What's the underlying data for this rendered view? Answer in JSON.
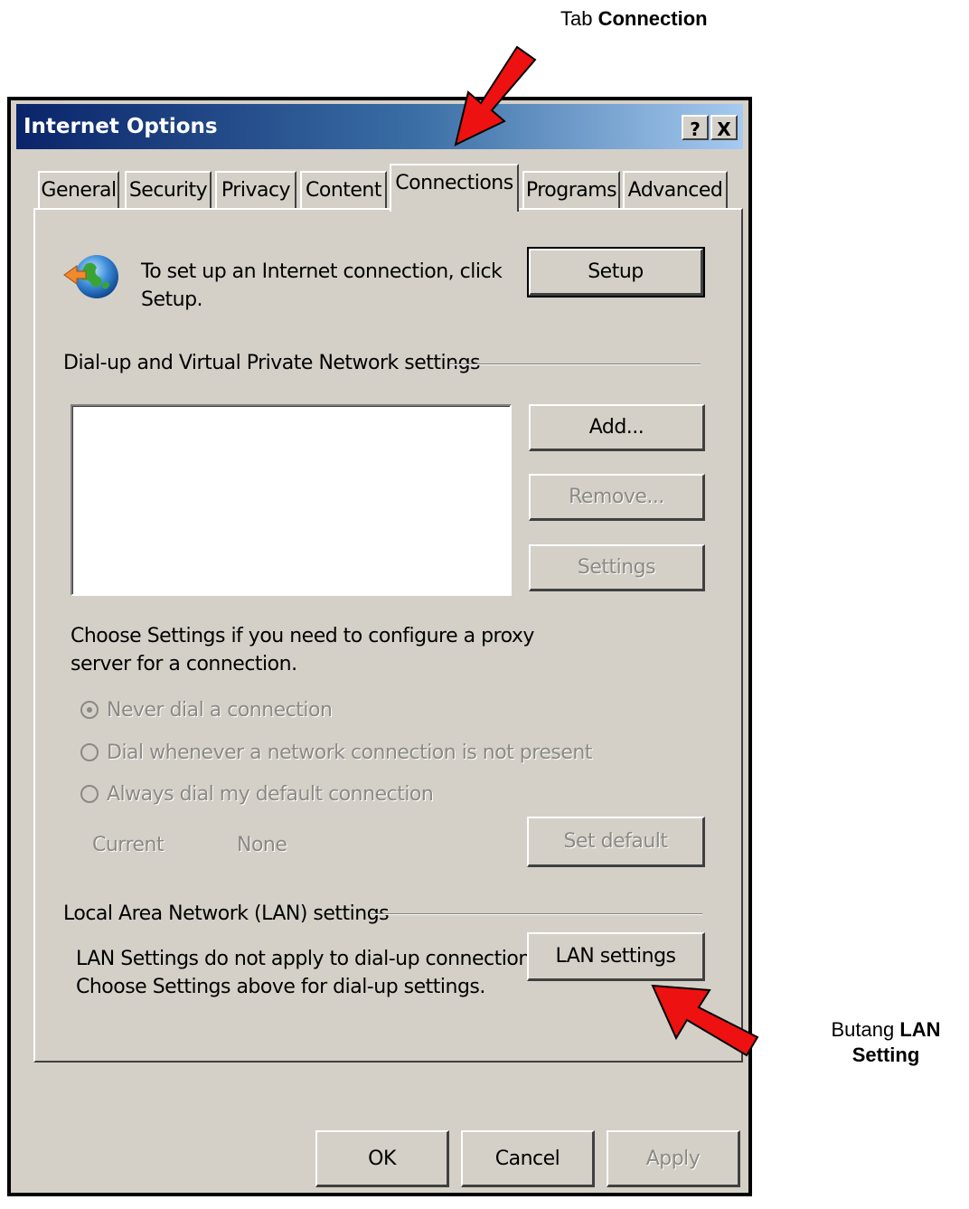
{
  "annotations": {
    "tab_prefix": "Tab ",
    "tab_bold": "Connection",
    "button_prefix": "Butang ",
    "button_bold_1": "LAN",
    "button_bold_2": "Setting"
  },
  "dialog": {
    "title": "Internet Options",
    "help_label": "?",
    "close_label": "X"
  },
  "tabs": [
    {
      "label": "General"
    },
    {
      "label": "Security"
    },
    {
      "label": "Privacy"
    },
    {
      "label": "Content"
    },
    {
      "label": "Connections",
      "active": true
    },
    {
      "label": "Programs"
    },
    {
      "label": "Advanced"
    }
  ],
  "setup": {
    "text_line1": "To set up an Internet connection, click",
    "text_line2": "Setup.",
    "button_label": "Setup"
  },
  "dialup": {
    "group_label": "Dial-up and Virtual Private Network settings",
    "add_label": "Add...",
    "remove_label": "Remove...",
    "settings_label": "Settings",
    "hint_line1": "Choose Settings if you need to configure a proxy",
    "hint_line2": "server for a connection.",
    "options": [
      {
        "label": "Never dial a connection",
        "checked": true
      },
      {
        "label": "Dial whenever a network connection is not present",
        "checked": false
      },
      {
        "label": "Always dial my default connection",
        "checked": false
      }
    ],
    "current_label": "Current",
    "current_value": "None",
    "set_default_label": "Set default"
  },
  "lan": {
    "group_label": "Local Area Network (LAN) settings",
    "text_line1": "LAN Settings do not apply to dial-up connections.",
    "text_line2": "Choose Settings above for dial-up settings.",
    "button_label": "LAN settings"
  },
  "footer": {
    "ok_label": "OK",
    "cancel_label": "Cancel",
    "apply_label": "Apply"
  },
  "colors": {
    "dialog_bg": "#d4d0c8",
    "titlebar_start": "#0a246a",
    "titlebar_end": "#a6caf0",
    "arrow": "#ee1111"
  },
  "icons": [
    "globe-arrow-icon",
    "red-arrow-icon",
    "radio-icon"
  ]
}
